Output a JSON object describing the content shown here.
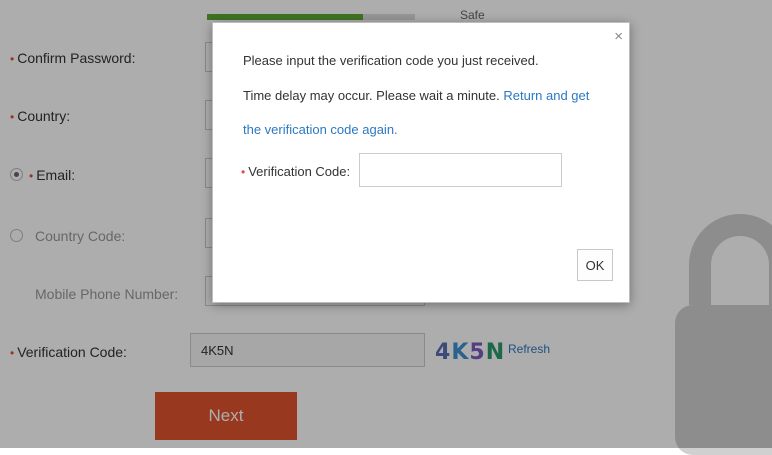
{
  "form": {
    "strength_label": "Safe",
    "confirm_password_label": "Confirm Password:",
    "country_label": "Country:",
    "email_label": "Email:",
    "country_code_label": "Country Code:",
    "mobile_label": "Mobile Phone Number:",
    "verification_label": "Verification Code:",
    "verification_value": "4K5N",
    "captcha_text": "4K5N",
    "refresh_label": "Refresh",
    "next_label": "Next",
    "required_marker": "•"
  },
  "dialog": {
    "close_glyph": "×",
    "line1": "Please input the verification code you just received.",
    "line2": "Time delay may occur. Please wait a minute.",
    "link_part1": "Return and get",
    "link_part2": "the verification code again.",
    "code_label": "Verification Code:",
    "ok_label": "OK"
  },
  "colors": {
    "accent": "#e0532f",
    "link": "#2b78c2",
    "strength": "#5fa832"
  }
}
